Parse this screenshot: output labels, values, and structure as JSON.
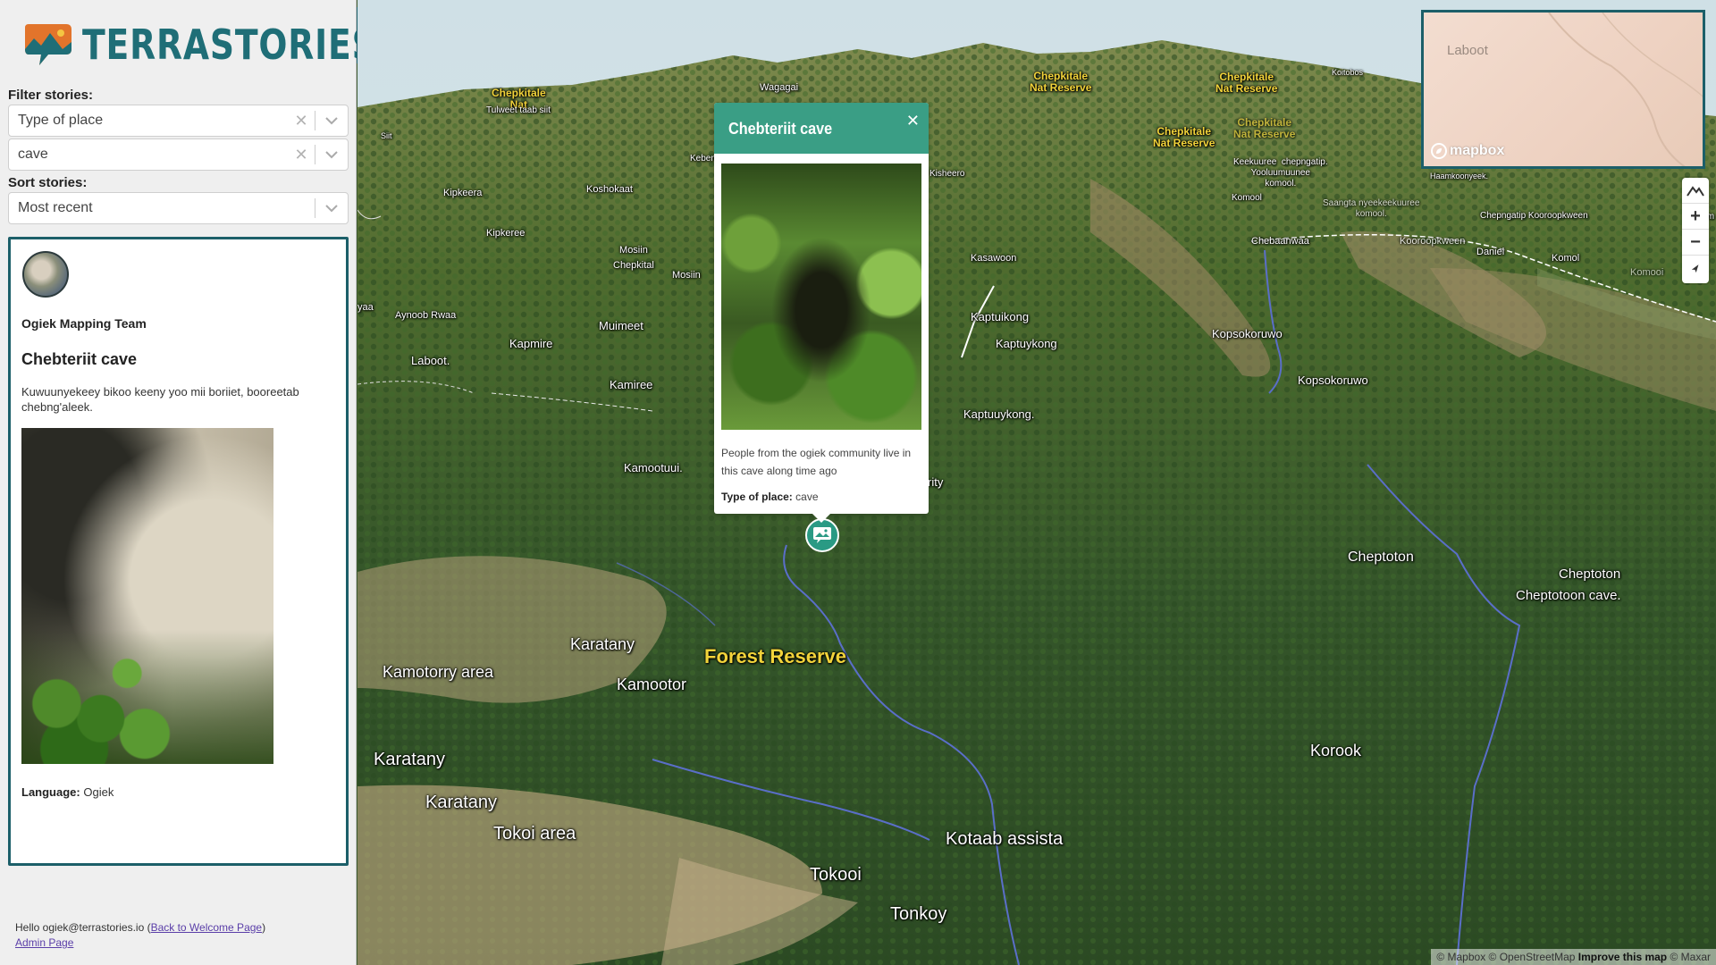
{
  "app": {
    "logo_text": "TERRASTORIES"
  },
  "filters": {
    "label": "Filter stories:",
    "type_select": {
      "value": "Type of place"
    },
    "value_select": {
      "value": "cave"
    }
  },
  "sort": {
    "label": "Sort stories:",
    "value": "Most recent"
  },
  "story_card": {
    "author": "Ogiek Mapping Team",
    "title": "Chebteriit cave",
    "description": "Kuwuunyekeey bikoo keeny yoo mii boriiet, booreetab chebng'aleek.",
    "language_label": "Language:",
    "language_value": "Ogiek"
  },
  "footer": {
    "greeting": "Hello ogiek@terrastories.io (",
    "back_link": "Back to Welcome Page",
    "greeting_end": ")",
    "admin_link": "Admin Page"
  },
  "popup": {
    "title": "Chebteriit cave",
    "description": "People from the ogiek community live in this cave along time ago",
    "type_label": "Type of place:",
    "type_value": "cave"
  },
  "minimap": {
    "label": "Laboot",
    "logo": "mapbox"
  },
  "attribution": {
    "mapbox": "© Mapbox",
    "osm": "© OpenStreetMap",
    "improve": "Improve this map",
    "maxar": "© Maxar"
  },
  "map_labels": {
    "chep1": "Chepkitale\nNat Reserve",
    "chep2": "Chepkitale\nNat Reserve",
    "chep3": "Chepkitale\nNat Reserve",
    "chep4": "Chepkitale\nNat Reserve",
    "chep5": "Chepkitale\nNat",
    "wagagai": "Wagagai",
    "koitobos": "Koitobos",
    "tulweet": "Tulweet taab siit",
    "siit": "Siit",
    "keben": "Keben",
    "kisheero": "Kisheero",
    "kipkeera": "Kipkeera",
    "koshokaat": "Koshokaat",
    "kipkeree": "Kipkeree",
    "mosiin_chep": "Mosiin\nChepkital",
    "mosiin": "Mosiin",
    "kasawoon": "Kasawoon",
    "keekuuree": "Keekuuree  chepngatip.\nYooluumuunee\nkomool.",
    "komool": "Komool",
    "saangta": "Saangta nyeekeekuuree\nkomool.",
    "chepngatip": "Chepngatip  Kooroopkween",
    "haamkoonyeek": "Haamkoonyeek.",
    "chebaanwaa": "Chebaanwaa",
    "kooroopkween": "Kooroopkween",
    "daniel": "Daniel",
    "komol": "Komol",
    "komooi": "Komooi",
    "koom": "Koom",
    "aynoob": "Aynoob Rwaa",
    "yaa": "yaa",
    "laboot": "Laboot.",
    "kapmire": "Kapmire",
    "muimeet": "Muimeet",
    "kaptuikong": "Kaptuikong",
    "kaptuykong": "Kaptuykong",
    "kopsokoruwo1": "Kopsokoruwo",
    "kopsokoruwo2": "Kopsokoruwo",
    "kamiree": "Kamiree",
    "kaptuuykong": "Kaptuuykong.",
    "kamootuui": "Kamootuui.",
    "rity": "rity",
    "cheptoton": "Cheptoton",
    "cheptoton2": "Cheptoton",
    "cheptotoon_cave": "Cheptotoon cave.",
    "karatany1": "Karatany",
    "forest_reserve": "Forest Reserve",
    "kamotorry": "Kamotorry area",
    "kamootor": "Kamootor",
    "karatany2": "Karatany",
    "karatany3": "Karatany",
    "tokoi_area": "Tokoi area",
    "korook": "Korook",
    "kotaab": "Kotaab assista",
    "tokooi": "Tokooi",
    "tonkoy": "Tonkoy"
  }
}
